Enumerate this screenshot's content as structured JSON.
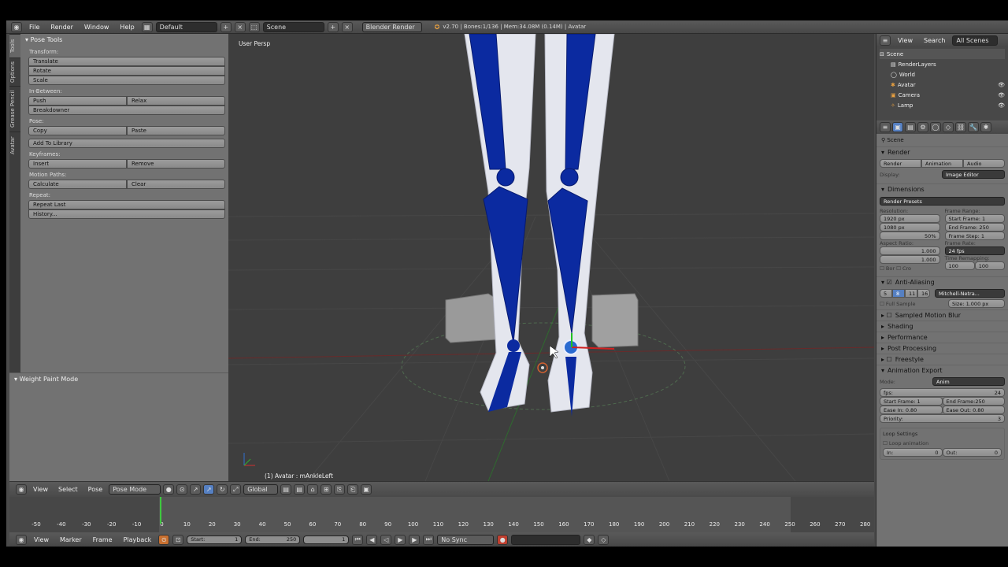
{
  "topbar": {
    "menus": [
      "File",
      "Render",
      "Window",
      "Help"
    ],
    "screen_layout": "Default",
    "scene": "Scene",
    "engine": "Blender Render",
    "status": "v2.70 | Bones:1/136 | Mem:34.08M (0.14M) | Avatar"
  },
  "left_tabs": [
    "Tools",
    "Options",
    "Grease Pencil",
    "Avatar"
  ],
  "pose_tools": {
    "title": "Pose Tools",
    "transform_label": "Transform:",
    "translate": "Translate",
    "rotate": "Rotate",
    "scale": "Scale",
    "inbetween_label": "In-Between:",
    "push": "Push",
    "relax": "Relax",
    "breakdowner": "Breakdowner",
    "pose_label": "Pose:",
    "copy": "Copy",
    "paste": "Paste",
    "add_library": "Add To Library",
    "keyframes_label": "Keyframes:",
    "insert": "Insert",
    "remove": "Remove",
    "motion_label": "Motion Paths:",
    "calculate": "Calculate",
    "clear": "Clear",
    "repeat_label": "Repeat:",
    "repeat_last": "Repeat Last",
    "history": "History..."
  },
  "weight_panel": {
    "title": "Weight Paint Mode"
  },
  "viewport": {
    "persp": "User Persp",
    "active": "(1) Avatar : mAnkleLeft"
  },
  "view_header": {
    "view": "View",
    "select": "Select",
    "pose": "Pose",
    "mode": "Pose Mode",
    "orientation": "Global"
  },
  "timeline": {
    "ticks": [
      "-50",
      "-40",
      "-30",
      "-20",
      "-10",
      "0",
      "10",
      "20",
      "30",
      "40",
      "50",
      "60",
      "70",
      "80",
      "90",
      "100",
      "110",
      "120",
      "130",
      "140",
      "150",
      "160",
      "170",
      "180",
      "190",
      "200",
      "210",
      "220",
      "230",
      "240",
      "250",
      "260",
      "270",
      "280"
    ],
    "current_frame": 1,
    "start_label": "Start:",
    "start": "1",
    "end_label": "End:",
    "end": "250",
    "frame": "1",
    "view": "View",
    "marker": "Marker",
    "frame_menu": "Frame",
    "playback": "Playback",
    "sync": "No Sync"
  },
  "outliner": {
    "view": "View",
    "search": "Search",
    "filter": "All Scenes",
    "items": [
      "Scene",
      "RenderLayers",
      "World",
      "Avatar",
      "Camera",
      "Lamp"
    ]
  },
  "properties": {
    "scene": "Scene",
    "render_section": "Render",
    "render_btn": "Render",
    "anim_btn": "Animation",
    "audio_btn": "Audio",
    "display_label": "Display:",
    "display_value": "Image Editor",
    "dimensions": "Dimensions",
    "presets": "Render Presets",
    "resolution_label": "Resolution:",
    "res_x": "1920 px",
    "res_y": "1080 px",
    "res_pct": "50%",
    "frame_range_label": "Frame Range:",
    "start_frame": "Start Frame: 1",
    "end_frame": "End Frame: 250",
    "frame_step": "Frame Step: 1",
    "aspect_label": "Aspect Ratio:",
    "asp_x": "1.000",
    "asp_y": "1.000",
    "frame_rate_label": "Frame Rate:",
    "fps": "24 fps",
    "time_remap_label": "Time Remapping:",
    "remap_old": "100",
    "remap_new": "100",
    "bor": "Bor",
    "cro": "Cro",
    "aa": "Anti-Aliasing",
    "aa_levels": [
      "5",
      "8",
      "11",
      "16"
    ],
    "aa_filter": "Mitchell-Netra...",
    "full_sample": "Full Sample",
    "size": "Size: 1.000 px",
    "sampled_motion": "Sampled Motion Blur",
    "shading": "Shading",
    "performance": "Performance",
    "post": "Post Processing",
    "freestyle": "Freestyle",
    "anim_export": "Animation Export",
    "mode_label": "Mode:",
    "mode_value": "Anim",
    "fps_label": "fps:",
    "fps_value": "24",
    "exp_start": "Start Frame: 1",
    "exp_end": "End Frame:250",
    "ease_in": "Ease In: 0.80",
    "ease_out": "Ease Out: 0.80",
    "priority": "Priority:",
    "priority_value": "3",
    "loop_settings": "Loop Settings",
    "loop_anim": "Loop animation",
    "loop_in": "In:",
    "loop_in_v": "0",
    "loop_out": "Out:",
    "loop_out_v": "0"
  },
  "colors": {
    "bone_blue": "#0b2aa0",
    "mesh": "#e4e6ee",
    "accent": "#5680c2",
    "playhead": "#3ec93e"
  }
}
